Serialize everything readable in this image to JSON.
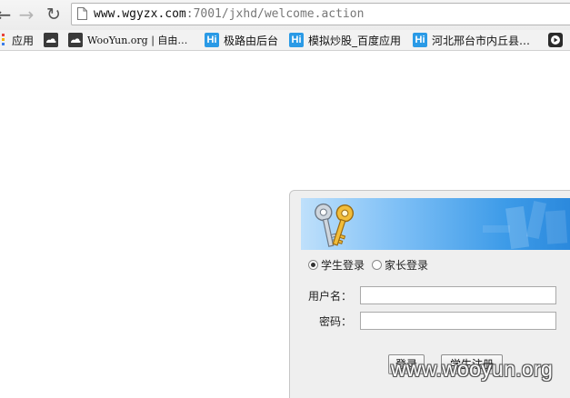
{
  "browser": {
    "url_host": "www.wgyzx.com",
    "url_rest": ":7001/jxhd/welcome.action",
    "nav": {
      "back_icon": "back-arrow-icon",
      "forward_icon": "forward-arrow-icon",
      "reload_icon": "reload-icon"
    }
  },
  "bookmarks": [
    {
      "label": "应用",
      "icon": "apps-grid-icon"
    },
    {
      "label": "",
      "icon": "cloud-icon"
    },
    {
      "label": "WooYun.org | 自由…",
      "icon": "wooyun-icon"
    },
    {
      "label": "极路由后台",
      "icon": "hi-icon",
      "icon_text": "Hi"
    },
    {
      "label": "模拟炒股_百度应用",
      "icon": "hi-icon",
      "icon_text": "Hi"
    },
    {
      "label": "河北邢台市内丘县…",
      "icon": "hi-icon",
      "icon_text": "Hi"
    },
    {
      "label": "",
      "icon": "play-icon"
    }
  ],
  "login": {
    "banner_icon": "keys-icon",
    "roles": [
      {
        "label": "学生登录",
        "checked": true
      },
      {
        "label": "家长登录",
        "checked": false
      }
    ],
    "username_label": "用户名：",
    "username_value": "",
    "password_label": "密码：",
    "password_value": "",
    "login_button": "登录",
    "register_button": "学生注册"
  },
  "watermark": "www.wooyun.org",
  "colors": {
    "banner_start": "#bfe0fb",
    "banner_end": "#2a88dc",
    "hi_icon": "#2a9ae6"
  }
}
